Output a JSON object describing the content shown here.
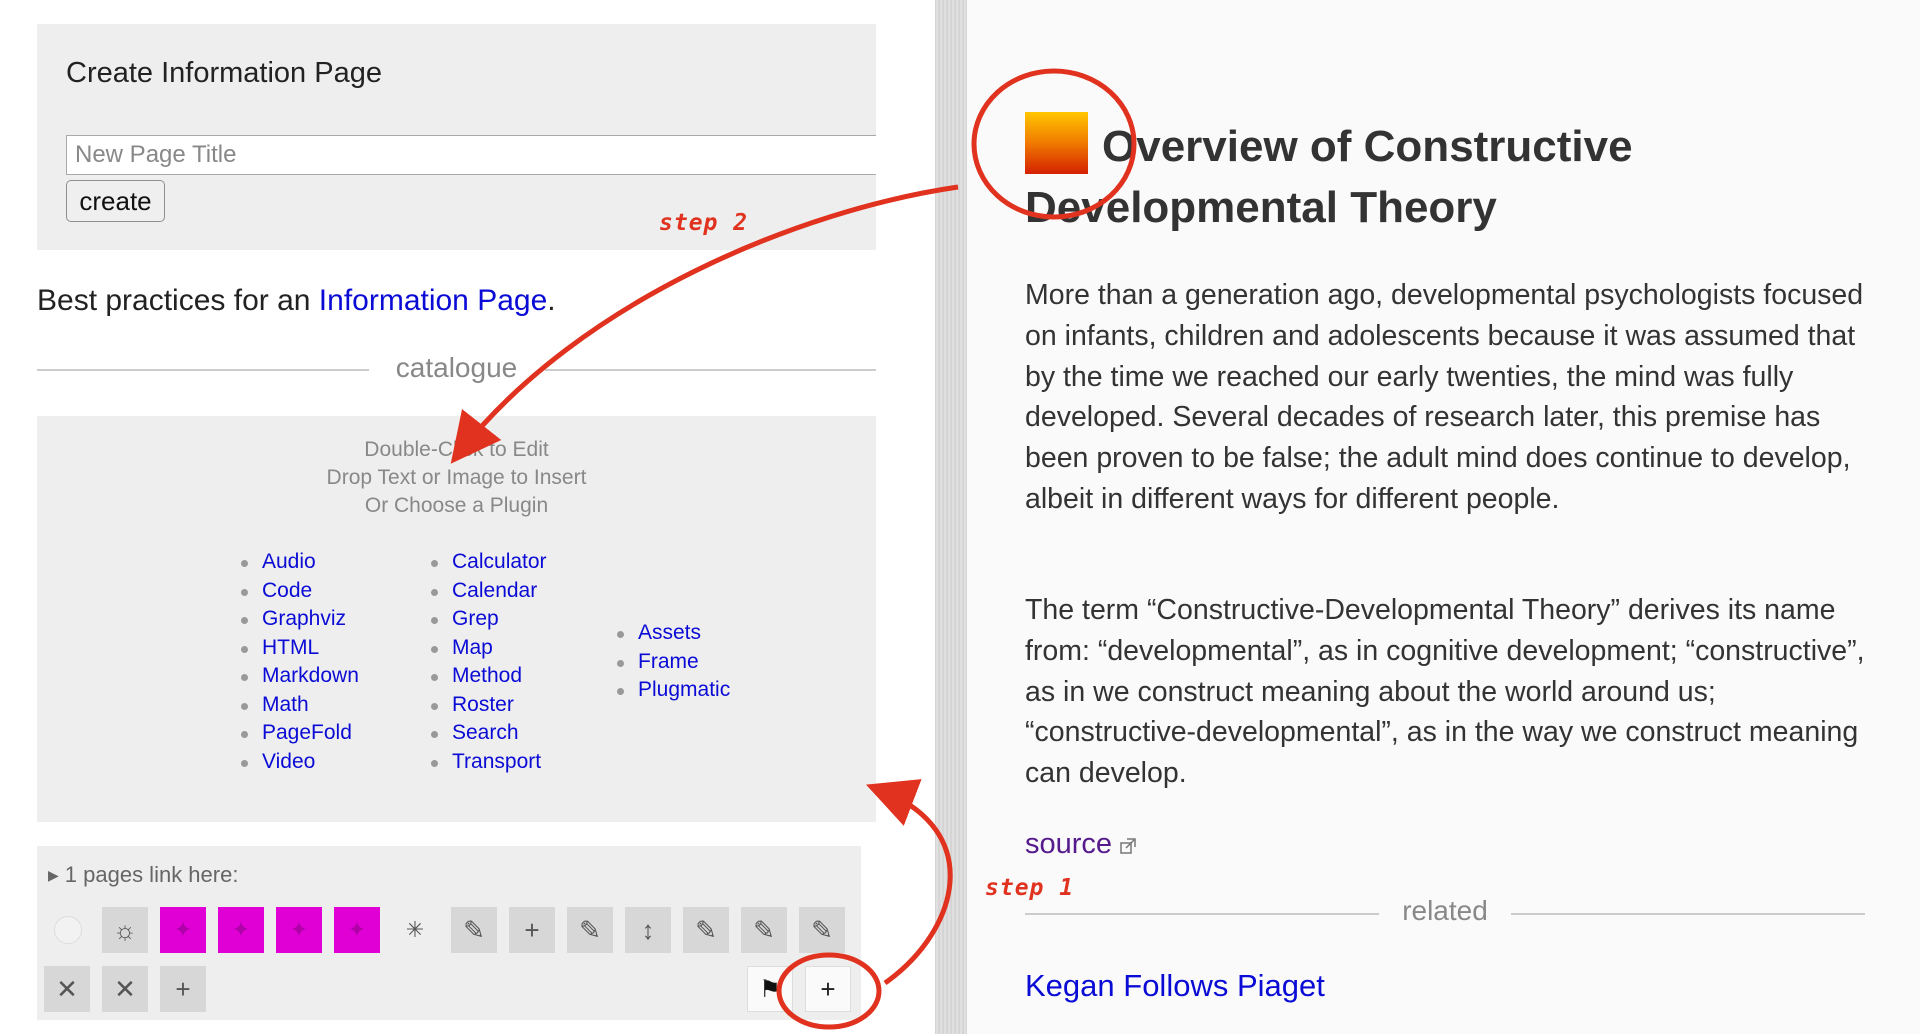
{
  "create_panel": {
    "title": "Create Information Page",
    "input_placeholder": "New Page Title",
    "create_button": "create"
  },
  "best_practices": {
    "prefix": "Best practices for an ",
    "link": "Information Page",
    "suffix": "."
  },
  "catalogue": {
    "heading": "catalogue",
    "hints": [
      "Double-Click to Edit",
      "Drop Text or Image to Insert",
      "Or Choose a Plugin"
    ],
    "columns": [
      [
        "Audio",
        "Code",
        "Graphviz",
        "HTML",
        "Markdown",
        "Math",
        "PageFold",
        "Video"
      ],
      [
        "Calculator",
        "Calendar",
        "Grep",
        "Map",
        "Method",
        "Roster",
        "Search",
        "Transport"
      ],
      [
        "Assets",
        "Frame",
        "Plugmatic"
      ]
    ]
  },
  "footer": {
    "backlinks": "1 pages link here:",
    "toolbar_row1_icons": [
      "journal-dot-icon",
      "sun-icon",
      "fork-icon",
      "fork-icon",
      "fork-icon",
      "fork-icon",
      "asterisk-icon",
      "pencil-icon",
      "plus-icon",
      "pencil-icon",
      "move-icon",
      "pencil-icon",
      "pencil-icon",
      "pencil-icon"
    ],
    "toolbar_row2_icons": [
      "close-icon",
      "close-icon",
      "plus-icon",
      "flag-icon",
      "plus-icon"
    ],
    "magenta_color": "#e000d6"
  },
  "page": {
    "title": "Overview of Constructive Developmental Theory",
    "paragraphs": [
      "More than a generation ago, developmental psychologists focused on infants, children and adolescents because it was assumed that by the time we reached our early twenties, the mind was fully developed. Several decades of research later, this premise has been proven to be false; the adult mind does continue to develop, albeit in different ways for different people.",
      "The term “Constructive-Developmental Theory” derives its name from: “developmental”, as in cognitive development; “constructive”, as in we construct meaning about the world around us; “constructive-developmental”, as in the way we construct meaning can develop."
    ],
    "source_link": "source",
    "related_heading": "related",
    "related_link": "Kegan Follows Piaget"
  },
  "annotations": {
    "step1": "step 1",
    "step2": "step 2",
    "color": "#e0321e"
  }
}
